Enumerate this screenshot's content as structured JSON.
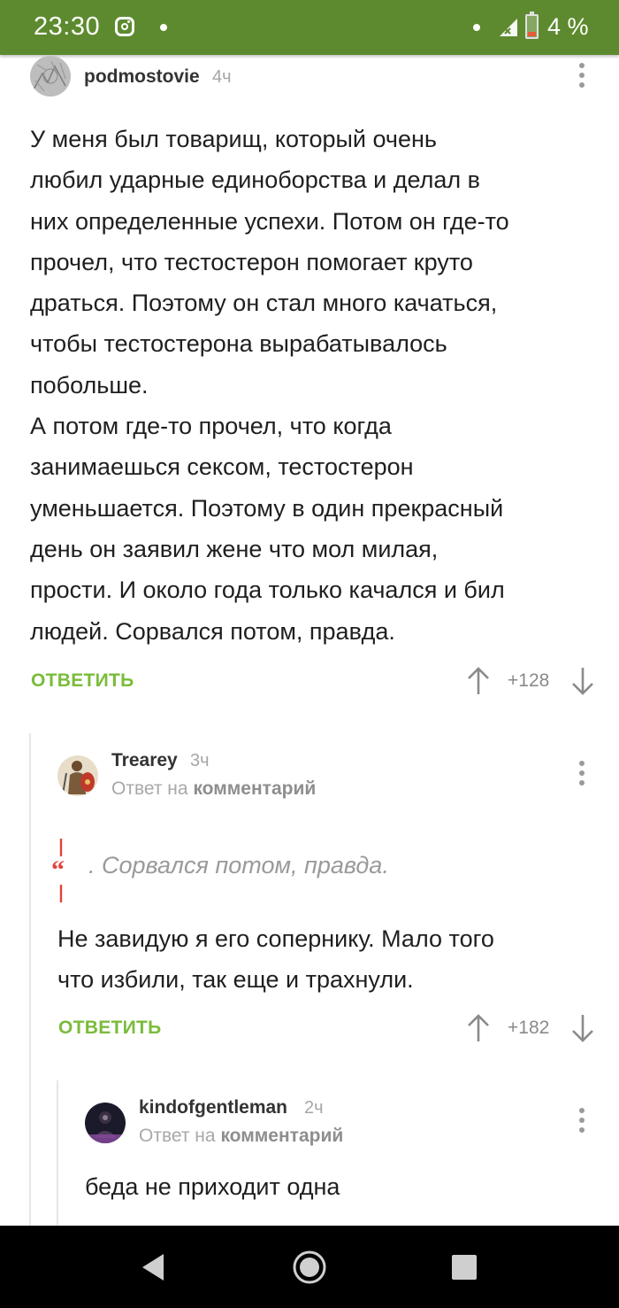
{
  "status_bar": {
    "time": "23:30",
    "battery_text": "4 %",
    "battery_level": 0.04,
    "background_color": "#5d8a2e",
    "icons": [
      "instagram-icon",
      "notification-dot-icon",
      "wifi-dot-icon",
      "signal-icon",
      "battery-icon"
    ]
  },
  "comments": [
    {
      "username": "podmostovie",
      "time": "4ч",
      "lines": [
        "У меня был товарищ, который очень",
        "любил ударные единоборства и делал в",
        "них определенные успехи. Потом он где-то",
        "прочел, что тестостерон помогает круто",
        "драться. Поэтому он стал много качаться,",
        "чтобы тестостерона вырабатывалось",
        "побольше.",
        "А потом где-то прочел, что когда",
        "занимаешься сексом, тестостерон",
        "уменьшается. Поэтому в один прекрасный",
        "день он заявил жене что мол милая,",
        "прости. И около года только качался и бил",
        "людей. Сорвался потом, правда."
      ],
      "reply_label": "ОТВЕТИТЬ",
      "rating": "+128"
    },
    {
      "username": "Trearey",
      "time": "3ч",
      "reply_prefix": "Ответ на",
      "reply_target": "комментарий",
      "quote": ". Сорвался потом, правда.",
      "lines": [
        "Не завидую я его сопернику. Мало того",
        "что избили, так еще и трахнули."
      ],
      "reply_label": "ОТВЕТИТЬ",
      "rating": "+182"
    },
    {
      "username": "kindofgentleman",
      "time": "2ч",
      "reply_prefix": "Ответ на",
      "reply_target": "комментарий",
      "lines": [
        "беда не приходит одна"
      ]
    }
  ],
  "colors": {
    "accent_green": "#79bc3a",
    "quote_red": "#e0443a"
  },
  "nav_bar": {
    "icons": [
      "back-icon",
      "home-icon",
      "recents-icon"
    ]
  }
}
